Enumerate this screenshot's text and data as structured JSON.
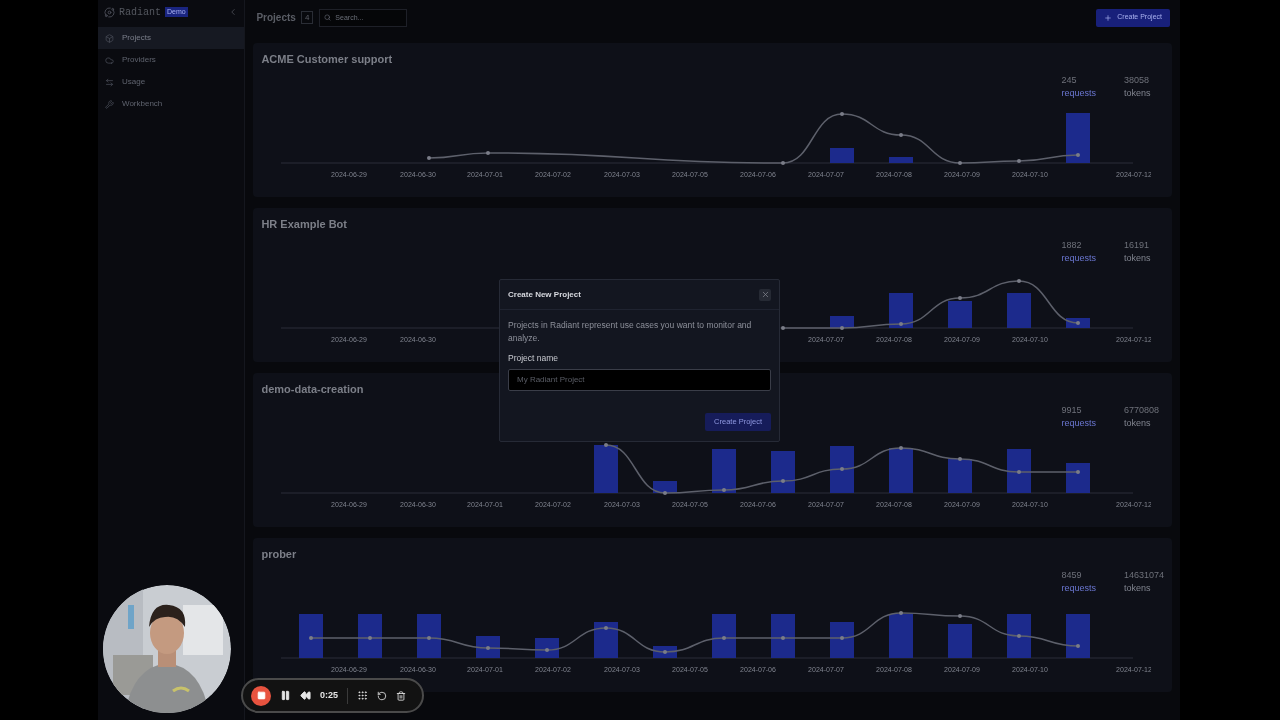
{
  "sidebar": {
    "brand": "Radiant",
    "badge": "Demo",
    "items": [
      {
        "label": "Projects",
        "selected": true
      },
      {
        "label": "Providers",
        "selected": false
      },
      {
        "label": "Usage",
        "selected": false
      },
      {
        "label": "Workbench",
        "selected": false
      }
    ]
  },
  "header": {
    "title": "Projects",
    "count": "4",
    "search": {
      "placeholder": "Search..."
    },
    "create_button": "Create Project"
  },
  "projects": [
    {
      "name": "ACME Customer support",
      "requests": "245",
      "requests_label": "requests",
      "tokens": "38058",
      "tokens_label": "tokens",
      "dates": [
        "2024-06-29",
        "2024-06-30",
        "2024-07-01",
        "2024-07-02",
        "2024-07-03",
        "2024-07-05",
        "2024-07-06",
        "2024-07-07",
        "2024-07-08",
        "2024-07-09",
        "2024-07-10",
        "2024-07-12"
      ]
    },
    {
      "name": "HR Example Bot",
      "requests": "1882",
      "requests_label": "requests",
      "tokens": "16191",
      "tokens_label": "tokens",
      "dates": [
        "2024-06-29",
        "2024-06-30",
        "2024-07-07",
        "2024-07-08",
        "2024-07-09",
        "2024-07-10",
        "2024-07-12"
      ]
    },
    {
      "name": "demo-data-creation",
      "requests": "9915",
      "requests_label": "requests",
      "tokens": "6770808",
      "tokens_label": "tokens",
      "dates": [
        "2024-06-29",
        "2024-06-30",
        "2024-07-01",
        "2024-07-02",
        "2024-07-03",
        "2024-07-05",
        "2024-07-06",
        "2024-07-07",
        "2024-07-08",
        "2024-07-09",
        "2024-07-10",
        "2024-07-12"
      ]
    },
    {
      "name": "prober",
      "requests": "8459",
      "requests_label": "requests",
      "tokens": "14631074",
      "tokens_label": "tokens",
      "dates": [
        "2024-06-29",
        "2024-06-30",
        "2024-07-01",
        "2024-07-02",
        "2024-07-03",
        "2024-07-05",
        "2024-07-06",
        "2024-07-07",
        "2024-07-08",
        "2024-07-09",
        "2024-07-10",
        "2024-07-12"
      ]
    }
  ],
  "dialog": {
    "title": "Create New Project",
    "description": "Projects in Radiant represent use cases you want to monitor and analyze.",
    "field_label": "Project name",
    "field": {
      "placeholder": "My Radiant Project"
    },
    "submit": "Create Project",
    "submit_disabled": true
  },
  "recorder": {
    "time": "0:25"
  }
}
